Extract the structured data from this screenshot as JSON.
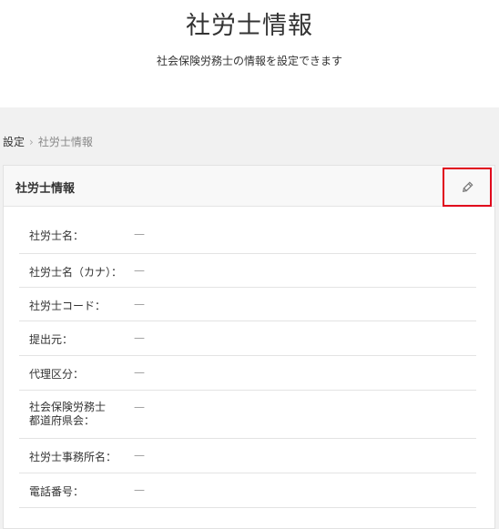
{
  "page": {
    "title": "社労士情報",
    "subtitle": "社会保険労務士の情報を設定できます"
  },
  "breadcrumb": {
    "parent": "設定",
    "separator": "›",
    "current": "社労士情報"
  },
  "card": {
    "title": "社労士情報",
    "edit_icon": "pencil-icon",
    "highlight_color": "#e0001b",
    "rows": [
      {
        "label": "社労士名：",
        "value": "—"
      },
      {
        "label": "社労士名（カナ）：",
        "value": "—"
      },
      {
        "label": "社労士コード：",
        "value": "—"
      },
      {
        "label": "提出元：",
        "value": "—"
      },
      {
        "label": "代理区分：",
        "value": "—"
      },
      {
        "label": "社会保険労務士\n都道府県会：",
        "value": "—"
      },
      {
        "label": "社労士事務所名：",
        "value": "—"
      },
      {
        "label": "電話番号：",
        "value": "—"
      }
    ]
  }
}
